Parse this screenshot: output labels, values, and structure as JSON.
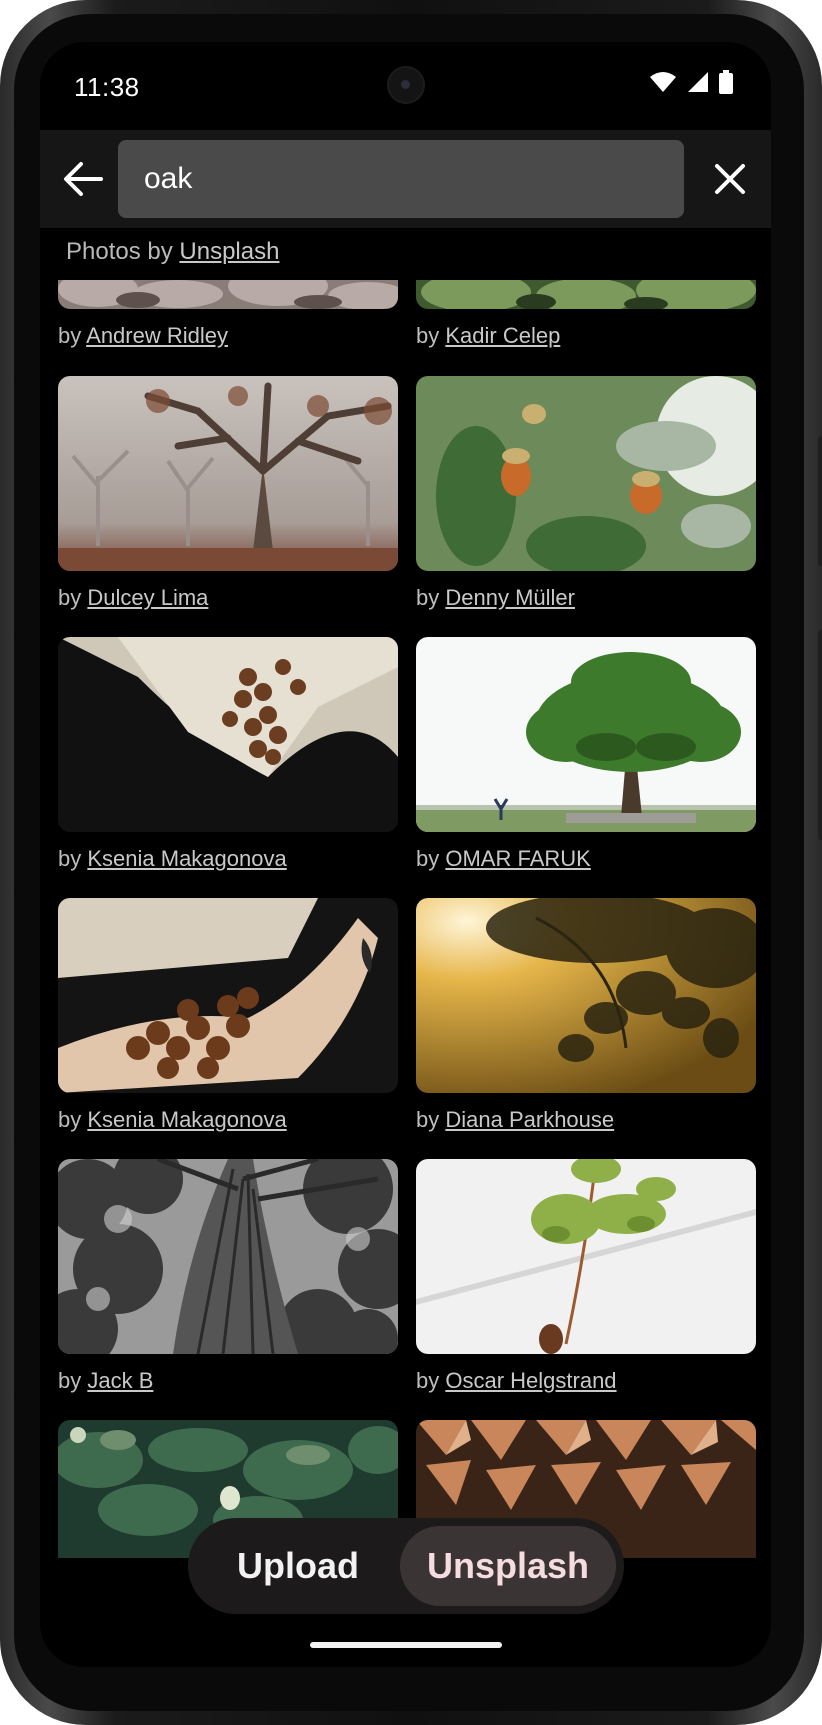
{
  "status_bar": {
    "time": "11:38"
  },
  "search": {
    "query": "oak"
  },
  "credit": {
    "prefix": "Photos by ",
    "link": "Unsplash"
  },
  "photos": [
    {
      "by": "by ",
      "author": "Andrew Ridley",
      "subject": "frost-covered oak leaves"
    },
    {
      "by": "by ",
      "author": "Kadir Celep",
      "subject": "green oak leaves"
    },
    {
      "by": "by ",
      "author": "Dulcey Lima",
      "subject": "bare oak trees in fog"
    },
    {
      "by": "by ",
      "author": "Denny Müller",
      "subject": "acorns on oak branch"
    },
    {
      "by": "by ",
      "author": "Ksenia Makagonova",
      "subject": "acorns in linen cloth"
    },
    {
      "by": "by ",
      "author": "OMAR FARUK",
      "subject": "lone oak tree in field"
    },
    {
      "by": "by ",
      "author": "Ksenia Makagonova",
      "subject": "hands holding acorns"
    },
    {
      "by": "by ",
      "author": "Diana Parkhouse",
      "subject": "oak leaves against golden sun"
    },
    {
      "by": "by ",
      "author": "Jack B",
      "subject": "black and white oak canopy"
    },
    {
      "by": "by ",
      "author": "Oscar Helgstrand",
      "subject": "oak seedling"
    },
    {
      "by": "",
      "author": "",
      "subject": "green oak leaves with acorn"
    },
    {
      "by": "",
      "author": "",
      "subject": "stacked firewood"
    }
  ],
  "bottom_toggle": {
    "upload": "Upload",
    "unsplash": "Unsplash",
    "selected": "Unsplash"
  },
  "colors": {
    "background": "#000000",
    "appbar": "#161616",
    "search_field": "#4a4a4a",
    "toggle_selected": "#3b3434",
    "toggle_selected_text": "#f4dce0"
  },
  "icons": [
    "back-arrow-icon",
    "close-icon",
    "wifi-icon",
    "signal-icon",
    "battery-icon"
  ]
}
